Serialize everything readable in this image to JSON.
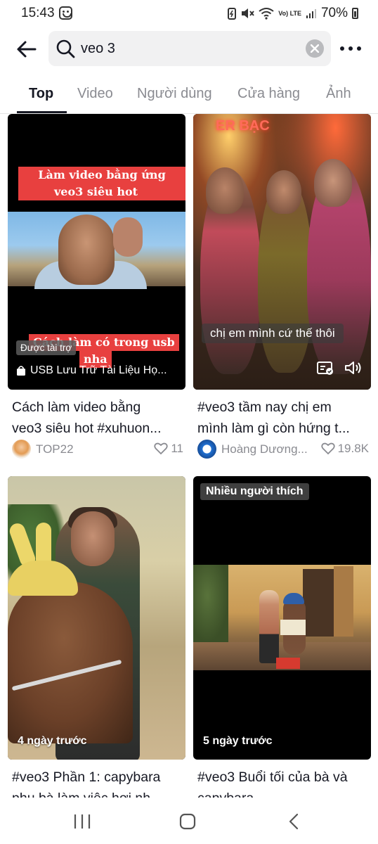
{
  "status_bar": {
    "time": "15:43",
    "network": "Vo) LTE",
    "battery": "70%"
  },
  "search": {
    "query": "veo 3"
  },
  "tabs": [
    {
      "label": "Top",
      "active": true
    },
    {
      "label": "Video",
      "active": false
    },
    {
      "label": "Người dùng",
      "active": false
    },
    {
      "label": "Cửa hàng",
      "active": false
    },
    {
      "label": "Ảnh",
      "active": false
    }
  ],
  "results": [
    {
      "thumbnail_texts": [
        "Làm video bằng ứng dụng",
        "veo3 siêu hot",
        "Cách làm có trong usb",
        "nha"
      ],
      "sponsored_label": "Được tài trợ",
      "shop_line": "USB Lưu Trữ Tài Liệu Họ...",
      "caption_line1": "Cách làm video bằng",
      "caption_line2": "veo3 siêu hot #xuhuon...",
      "author": "TOP22",
      "likes": "11"
    },
    {
      "thumbnail_texts": [
        "chị em mình cứ thế thôi"
      ],
      "caption_line1": "#veo3 tầm nay chị em",
      "caption_line2": "mình làm gì còn hứng t...",
      "author": "Hoàng Dương...",
      "likes": "19.8K"
    },
    {
      "time_tag": "4 ngày trước",
      "caption_line1": "#veo3 Phần 1: capybara",
      "caption_line2": "phụ bà làm việc hơi nh..."
    },
    {
      "popular_label": "Nhiều người thích",
      "time_tag": "5 ngày trước",
      "caption_line1": "#veo3 Buổi tối của bà và",
      "caption_line2": "capybara"
    }
  ],
  "colors": {
    "text_primary": "#161823",
    "text_secondary": "#8a8b91",
    "search_bg": "#f1f1f2",
    "banner_red": "#e8403f"
  }
}
